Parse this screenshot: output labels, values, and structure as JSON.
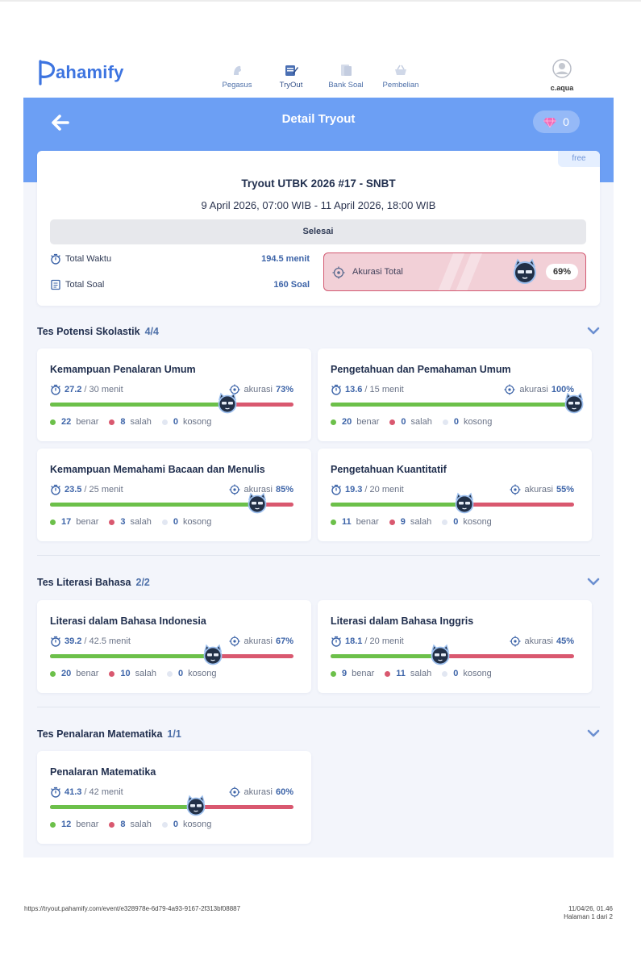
{
  "brand": {
    "logo_text": "ahamify",
    "accent": "#3d74e0"
  },
  "nav": {
    "items": [
      {
        "label": "Pegasus",
        "icon": "pegasus-icon"
      },
      {
        "label": "TryOut",
        "icon": "tryout-icon",
        "active": true
      },
      {
        "label": "Bank Soal",
        "icon": "bank-soal-icon"
      },
      {
        "label": "Pembelian",
        "icon": "basket-icon"
      }
    ],
    "user": "c.aqua"
  },
  "header": {
    "title": "Detail Tryout",
    "gems": "0",
    "band_color": "#6c9ff4"
  },
  "summary": {
    "tag": "free",
    "title": "Tryout UTBK 2026 #17 - SNBT",
    "dates": "9 April 2026, 07:00 WIB - 11 April 2026, 18:00 WIB",
    "status": "Selesai",
    "total_waktu_label": "Total Waktu",
    "total_waktu_value": "194.5 menit",
    "total_soal_label": "Total Soal",
    "total_soal_value": "160 Soal",
    "akurasi_label": "Akurasi Total",
    "akurasi_value": "69%"
  },
  "labels": {
    "menit": "menit",
    "akurasi": "akurasi",
    "benar": "benar",
    "salah": "salah",
    "kosong": "kosong"
  },
  "sections": [
    {
      "title": "Tes Potensi Skolastik",
      "count": "4/4",
      "cards": [
        {
          "title": "Kemampuan Penalaran Umum",
          "time_used": "27.2",
          "time_total": "/ 30 menit",
          "accuracy": "73%",
          "accuracy_value": 73,
          "benar": "22",
          "salah": "8",
          "kosong": "0"
        },
        {
          "title": "Pengetahuan dan Pemahaman Umum",
          "time_used": "13.6",
          "time_total": "/ 15 menit",
          "accuracy": "100%",
          "accuracy_value": 100,
          "benar": "20",
          "salah": "0",
          "kosong": "0"
        },
        {
          "title": "Kemampuan Memahami Bacaan dan Menulis",
          "time_used": "23.5",
          "time_total": "/ 25 menit",
          "accuracy": "85%",
          "accuracy_value": 85,
          "benar": "17",
          "salah": "3",
          "kosong": "0"
        },
        {
          "title": "Pengetahuan Kuantitatif",
          "time_used": "19.3",
          "time_total": "/ 20 menit",
          "accuracy": "55%",
          "accuracy_value": 55,
          "benar": "11",
          "salah": "9",
          "kosong": "0"
        }
      ]
    },
    {
      "title": "Tes Literasi Bahasa",
      "count": "2/2",
      "cards": [
        {
          "title": "Literasi dalam Bahasa Indonesia",
          "time_used": "39.2",
          "time_total": "/ 42.5 menit",
          "accuracy": "67%",
          "accuracy_value": 67,
          "benar": "20",
          "salah": "10",
          "kosong": "0"
        },
        {
          "title": "Literasi dalam Bahasa Inggris",
          "time_used": "18.1",
          "time_total": "/ 20 menit",
          "accuracy": "45%",
          "accuracy_value": 45,
          "benar": "9",
          "salah": "11",
          "kosong": "0"
        }
      ]
    },
    {
      "title": "Tes Penalaran Matematika",
      "count": "1/1",
      "cards": [
        {
          "title": "Penalaran Matematika",
          "time_used": "41.3",
          "time_total": "/ 42 menit",
          "accuracy": "60%",
          "accuracy_value": 60,
          "benar": "12",
          "salah": "8",
          "kosong": "0"
        }
      ]
    }
  ],
  "colors": {
    "benar": "#6cc04a",
    "salah": "#d9586f",
    "kosong": "#e2e7f2"
  },
  "footer": {
    "url": "https://tryout.pahamify.com/event/e328978e-6d79-4a93-9167-2f313bf08887",
    "datetime": "11/04/26, 01.46",
    "page": "Halaman 1 dari 2"
  }
}
